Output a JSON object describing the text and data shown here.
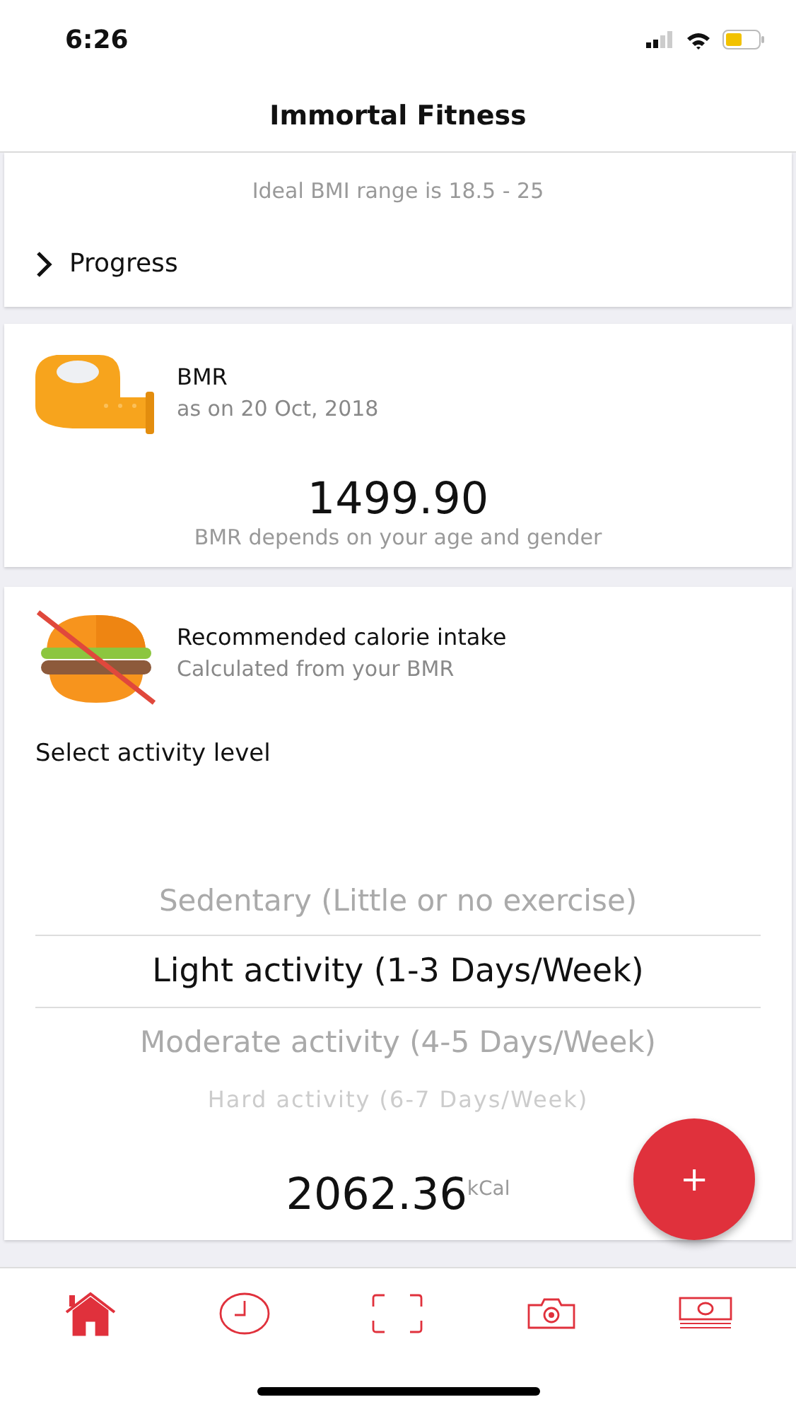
{
  "status_bar": {
    "time": "6:26"
  },
  "header": {
    "title": "Immortal Fitness"
  },
  "bmi_card": {
    "hint": "Ideal BMI range is 18.5 - 25",
    "progress_label": "Progress"
  },
  "bmr_card": {
    "title": "BMR",
    "subtitle": "as on 20 Oct, 2018",
    "value": "1499.90",
    "hint": "BMR depends on your age and gender"
  },
  "calorie_card": {
    "title": "Recommended calorie intake",
    "subtitle": "Calculated from your BMR",
    "picker_label": "Select activity level",
    "activity_options": [
      {
        "label": "Sedentary (Little or no exercise)",
        "selected": false
      },
      {
        "label": "Light activity (1-3 Days/Week)",
        "selected": true
      },
      {
        "label": "Moderate activity (4-5 Days/Week)",
        "selected": false
      },
      {
        "label": "Hard activity (6-7 Days/Week)",
        "selected": false
      }
    ],
    "value": "2062.36",
    "unit": "kCal"
  },
  "fab": {
    "label": "+"
  },
  "tab_bar": [
    {
      "kind": "home",
      "selected": true
    },
    {
      "kind": "clock",
      "selected": false
    },
    {
      "kind": "scan",
      "selected": false
    },
    {
      "kind": "camera",
      "selected": false
    },
    {
      "kind": "money",
      "selected": false
    }
  ]
}
